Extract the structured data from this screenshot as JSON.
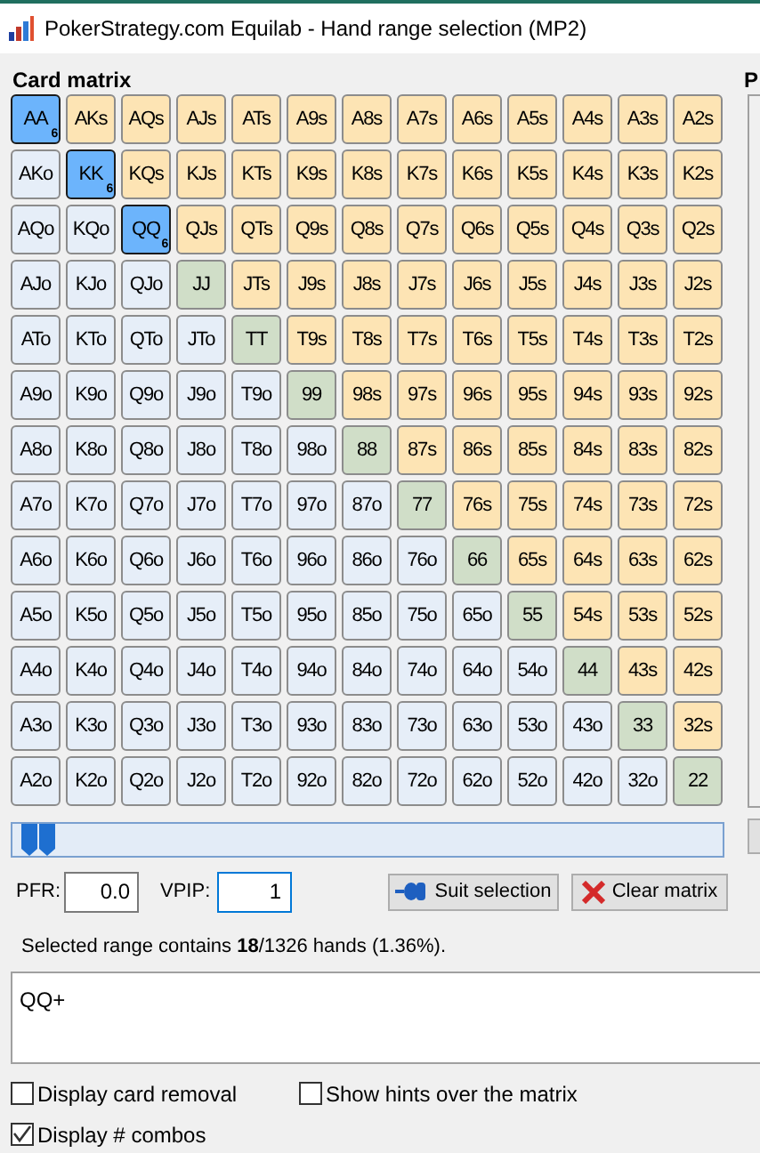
{
  "window": {
    "title": "PokerStrategy.com Equilab - Hand range selection (MP2)"
  },
  "card_matrix": {
    "title": "Card matrix",
    "rows": [
      [
        {
          "label": "AA",
          "kind": "pair",
          "selected": true,
          "combos": "6"
        },
        {
          "label": "AKs",
          "kind": "suited",
          "selected": false
        },
        {
          "label": "AQs",
          "kind": "suited",
          "selected": false
        },
        {
          "label": "AJs",
          "kind": "suited",
          "selected": false
        },
        {
          "label": "ATs",
          "kind": "suited",
          "selected": false
        },
        {
          "label": "A9s",
          "kind": "suited",
          "selected": false
        },
        {
          "label": "A8s",
          "kind": "suited",
          "selected": false
        },
        {
          "label": "A7s",
          "kind": "suited",
          "selected": false
        },
        {
          "label": "A6s",
          "kind": "suited",
          "selected": false
        },
        {
          "label": "A5s",
          "kind": "suited",
          "selected": false
        },
        {
          "label": "A4s",
          "kind": "suited",
          "selected": false
        },
        {
          "label": "A3s",
          "kind": "suited",
          "selected": false
        },
        {
          "label": "A2s",
          "kind": "suited",
          "selected": false
        }
      ],
      [
        {
          "label": "AKo",
          "kind": "offsuit",
          "selected": false
        },
        {
          "label": "KK",
          "kind": "pair",
          "selected": true,
          "combos": "6"
        },
        {
          "label": "KQs",
          "kind": "suited",
          "selected": false
        },
        {
          "label": "KJs",
          "kind": "suited",
          "selected": false
        },
        {
          "label": "KTs",
          "kind": "suited",
          "selected": false
        },
        {
          "label": "K9s",
          "kind": "suited",
          "selected": false
        },
        {
          "label": "K8s",
          "kind": "suited",
          "selected": false
        },
        {
          "label": "K7s",
          "kind": "suited",
          "selected": false
        },
        {
          "label": "K6s",
          "kind": "suited",
          "selected": false
        },
        {
          "label": "K5s",
          "kind": "suited",
          "selected": false
        },
        {
          "label": "K4s",
          "kind": "suited",
          "selected": false
        },
        {
          "label": "K3s",
          "kind": "suited",
          "selected": false
        },
        {
          "label": "K2s",
          "kind": "suited",
          "selected": false
        }
      ],
      [
        {
          "label": "AQo",
          "kind": "offsuit",
          "selected": false
        },
        {
          "label": "KQo",
          "kind": "offsuit",
          "selected": false
        },
        {
          "label": "QQ",
          "kind": "pair",
          "selected": true,
          "combos": "6"
        },
        {
          "label": "QJs",
          "kind": "suited",
          "selected": false
        },
        {
          "label": "QTs",
          "kind": "suited",
          "selected": false
        },
        {
          "label": "Q9s",
          "kind": "suited",
          "selected": false
        },
        {
          "label": "Q8s",
          "kind": "suited",
          "selected": false
        },
        {
          "label": "Q7s",
          "kind": "suited",
          "selected": false
        },
        {
          "label": "Q6s",
          "kind": "suited",
          "selected": false
        },
        {
          "label": "Q5s",
          "kind": "suited",
          "selected": false
        },
        {
          "label": "Q4s",
          "kind": "suited",
          "selected": false
        },
        {
          "label": "Q3s",
          "kind": "suited",
          "selected": false
        },
        {
          "label": "Q2s",
          "kind": "suited",
          "selected": false
        }
      ],
      [
        {
          "label": "AJo",
          "kind": "offsuit",
          "selected": false
        },
        {
          "label": "KJo",
          "kind": "offsuit",
          "selected": false
        },
        {
          "label": "QJo",
          "kind": "offsuit",
          "selected": false
        },
        {
          "label": "JJ",
          "kind": "pair",
          "selected": false
        },
        {
          "label": "JTs",
          "kind": "suited",
          "selected": false
        },
        {
          "label": "J9s",
          "kind": "suited",
          "selected": false
        },
        {
          "label": "J8s",
          "kind": "suited",
          "selected": false
        },
        {
          "label": "J7s",
          "kind": "suited",
          "selected": false
        },
        {
          "label": "J6s",
          "kind": "suited",
          "selected": false
        },
        {
          "label": "J5s",
          "kind": "suited",
          "selected": false
        },
        {
          "label": "J4s",
          "kind": "suited",
          "selected": false
        },
        {
          "label": "J3s",
          "kind": "suited",
          "selected": false
        },
        {
          "label": "J2s",
          "kind": "suited",
          "selected": false
        }
      ],
      [
        {
          "label": "ATo",
          "kind": "offsuit",
          "selected": false
        },
        {
          "label": "KTo",
          "kind": "offsuit",
          "selected": false
        },
        {
          "label": "QTo",
          "kind": "offsuit",
          "selected": false
        },
        {
          "label": "JTo",
          "kind": "offsuit",
          "selected": false
        },
        {
          "label": "TT",
          "kind": "pair",
          "selected": false
        },
        {
          "label": "T9s",
          "kind": "suited",
          "selected": false
        },
        {
          "label": "T8s",
          "kind": "suited",
          "selected": false
        },
        {
          "label": "T7s",
          "kind": "suited",
          "selected": false
        },
        {
          "label": "T6s",
          "kind": "suited",
          "selected": false
        },
        {
          "label": "T5s",
          "kind": "suited",
          "selected": false
        },
        {
          "label": "T4s",
          "kind": "suited",
          "selected": false
        },
        {
          "label": "T3s",
          "kind": "suited",
          "selected": false
        },
        {
          "label": "T2s",
          "kind": "suited",
          "selected": false
        }
      ],
      [
        {
          "label": "A9o",
          "kind": "offsuit",
          "selected": false
        },
        {
          "label": "K9o",
          "kind": "offsuit",
          "selected": false
        },
        {
          "label": "Q9o",
          "kind": "offsuit",
          "selected": false
        },
        {
          "label": "J9o",
          "kind": "offsuit",
          "selected": false
        },
        {
          "label": "T9o",
          "kind": "offsuit",
          "selected": false
        },
        {
          "label": "99",
          "kind": "pair",
          "selected": false
        },
        {
          "label": "98s",
          "kind": "suited",
          "selected": false
        },
        {
          "label": "97s",
          "kind": "suited",
          "selected": false
        },
        {
          "label": "96s",
          "kind": "suited",
          "selected": false
        },
        {
          "label": "95s",
          "kind": "suited",
          "selected": false
        },
        {
          "label": "94s",
          "kind": "suited",
          "selected": false
        },
        {
          "label": "93s",
          "kind": "suited",
          "selected": false
        },
        {
          "label": "92s",
          "kind": "suited",
          "selected": false
        }
      ],
      [
        {
          "label": "A8o",
          "kind": "offsuit",
          "selected": false
        },
        {
          "label": "K8o",
          "kind": "offsuit",
          "selected": false
        },
        {
          "label": "Q8o",
          "kind": "offsuit",
          "selected": false
        },
        {
          "label": "J8o",
          "kind": "offsuit",
          "selected": false
        },
        {
          "label": "T8o",
          "kind": "offsuit",
          "selected": false
        },
        {
          "label": "98o",
          "kind": "offsuit",
          "selected": false
        },
        {
          "label": "88",
          "kind": "pair",
          "selected": false
        },
        {
          "label": "87s",
          "kind": "suited",
          "selected": false
        },
        {
          "label": "86s",
          "kind": "suited",
          "selected": false
        },
        {
          "label": "85s",
          "kind": "suited",
          "selected": false
        },
        {
          "label": "84s",
          "kind": "suited",
          "selected": false
        },
        {
          "label": "83s",
          "kind": "suited",
          "selected": false
        },
        {
          "label": "82s",
          "kind": "suited",
          "selected": false
        }
      ],
      [
        {
          "label": "A7o",
          "kind": "offsuit",
          "selected": false
        },
        {
          "label": "K7o",
          "kind": "offsuit",
          "selected": false
        },
        {
          "label": "Q7o",
          "kind": "offsuit",
          "selected": false
        },
        {
          "label": "J7o",
          "kind": "offsuit",
          "selected": false
        },
        {
          "label": "T7o",
          "kind": "offsuit",
          "selected": false
        },
        {
          "label": "97o",
          "kind": "offsuit",
          "selected": false
        },
        {
          "label": "87o",
          "kind": "offsuit",
          "selected": false
        },
        {
          "label": "77",
          "kind": "pair",
          "selected": false
        },
        {
          "label": "76s",
          "kind": "suited",
          "selected": false
        },
        {
          "label": "75s",
          "kind": "suited",
          "selected": false
        },
        {
          "label": "74s",
          "kind": "suited",
          "selected": false
        },
        {
          "label": "73s",
          "kind": "suited",
          "selected": false
        },
        {
          "label": "72s",
          "kind": "suited",
          "selected": false
        }
      ],
      [
        {
          "label": "A6o",
          "kind": "offsuit",
          "selected": false
        },
        {
          "label": "K6o",
          "kind": "offsuit",
          "selected": false
        },
        {
          "label": "Q6o",
          "kind": "offsuit",
          "selected": false
        },
        {
          "label": "J6o",
          "kind": "offsuit",
          "selected": false
        },
        {
          "label": "T6o",
          "kind": "offsuit",
          "selected": false
        },
        {
          "label": "96o",
          "kind": "offsuit",
          "selected": false
        },
        {
          "label": "86o",
          "kind": "offsuit",
          "selected": false
        },
        {
          "label": "76o",
          "kind": "offsuit",
          "selected": false
        },
        {
          "label": "66",
          "kind": "pair",
          "selected": false
        },
        {
          "label": "65s",
          "kind": "suited",
          "selected": false
        },
        {
          "label": "64s",
          "kind": "suited",
          "selected": false
        },
        {
          "label": "63s",
          "kind": "suited",
          "selected": false
        },
        {
          "label": "62s",
          "kind": "suited",
          "selected": false
        }
      ],
      [
        {
          "label": "A5o",
          "kind": "offsuit",
          "selected": false
        },
        {
          "label": "K5o",
          "kind": "offsuit",
          "selected": false
        },
        {
          "label": "Q5o",
          "kind": "offsuit",
          "selected": false
        },
        {
          "label": "J5o",
          "kind": "offsuit",
          "selected": false
        },
        {
          "label": "T5o",
          "kind": "offsuit",
          "selected": false
        },
        {
          "label": "95o",
          "kind": "offsuit",
          "selected": false
        },
        {
          "label": "85o",
          "kind": "offsuit",
          "selected": false
        },
        {
          "label": "75o",
          "kind": "offsuit",
          "selected": false
        },
        {
          "label": "65o",
          "kind": "offsuit",
          "selected": false
        },
        {
          "label": "55",
          "kind": "pair",
          "selected": false
        },
        {
          "label": "54s",
          "kind": "suited",
          "selected": false
        },
        {
          "label": "53s",
          "kind": "suited",
          "selected": false
        },
        {
          "label": "52s",
          "kind": "suited",
          "selected": false
        }
      ],
      [
        {
          "label": "A4o",
          "kind": "offsuit",
          "selected": false
        },
        {
          "label": "K4o",
          "kind": "offsuit",
          "selected": false
        },
        {
          "label": "Q4o",
          "kind": "offsuit",
          "selected": false
        },
        {
          "label": "J4o",
          "kind": "offsuit",
          "selected": false
        },
        {
          "label": "T4o",
          "kind": "offsuit",
          "selected": false
        },
        {
          "label": "94o",
          "kind": "offsuit",
          "selected": false
        },
        {
          "label": "84o",
          "kind": "offsuit",
          "selected": false
        },
        {
          "label": "74o",
          "kind": "offsuit",
          "selected": false
        },
        {
          "label": "64o",
          "kind": "offsuit",
          "selected": false
        },
        {
          "label": "54o",
          "kind": "offsuit",
          "selected": false
        },
        {
          "label": "44",
          "kind": "pair",
          "selected": false
        },
        {
          "label": "43s",
          "kind": "suited",
          "selected": false
        },
        {
          "label": "42s",
          "kind": "suited",
          "selected": false
        }
      ],
      [
        {
          "label": "A3o",
          "kind": "offsuit",
          "selected": false
        },
        {
          "label": "K3o",
          "kind": "offsuit",
          "selected": false
        },
        {
          "label": "Q3o",
          "kind": "offsuit",
          "selected": false
        },
        {
          "label": "J3o",
          "kind": "offsuit",
          "selected": false
        },
        {
          "label": "T3o",
          "kind": "offsuit",
          "selected": false
        },
        {
          "label": "93o",
          "kind": "offsuit",
          "selected": false
        },
        {
          "label": "83o",
          "kind": "offsuit",
          "selected": false
        },
        {
          "label": "73o",
          "kind": "offsuit",
          "selected": false
        },
        {
          "label": "63o",
          "kind": "offsuit",
          "selected": false
        },
        {
          "label": "53o",
          "kind": "offsuit",
          "selected": false
        },
        {
          "label": "43o",
          "kind": "offsuit",
          "selected": false
        },
        {
          "label": "33",
          "kind": "pair",
          "selected": false
        },
        {
          "label": "32s",
          "kind": "suited",
          "selected": false
        }
      ],
      [
        {
          "label": "A2o",
          "kind": "offsuit",
          "selected": false
        },
        {
          "label": "K2o",
          "kind": "offsuit",
          "selected": false
        },
        {
          "label": "Q2o",
          "kind": "offsuit",
          "selected": false
        },
        {
          "label": "J2o",
          "kind": "offsuit",
          "selected": false
        },
        {
          "label": "T2o",
          "kind": "offsuit",
          "selected": false
        },
        {
          "label": "92o",
          "kind": "offsuit",
          "selected": false
        },
        {
          "label": "82o",
          "kind": "offsuit",
          "selected": false
        },
        {
          "label": "72o",
          "kind": "offsuit",
          "selected": false
        },
        {
          "label": "62o",
          "kind": "offsuit",
          "selected": false
        },
        {
          "label": "52o",
          "kind": "offsuit",
          "selected": false
        },
        {
          "label": "42o",
          "kind": "offsuit",
          "selected": false
        },
        {
          "label": "32o",
          "kind": "offsuit",
          "selected": false
        },
        {
          "label": "22",
          "kind": "pair",
          "selected": false
        }
      ]
    ]
  },
  "range_slider": {
    "level": 0.0136
  },
  "pfr": {
    "label": "PFR:",
    "value": "0.0"
  },
  "vpip": {
    "label": "VPIP:",
    "value": "1"
  },
  "buttons": [
    {
      "label": "Suit selection",
      "kind": "suit"
    },
    {
      "label": "Clear matrix",
      "kind": "clear"
    }
  ],
  "summary": "Selected range contains **18**/1326 hands (1.36%).",
  "range_text": "QQ+",
  "options": [
    {
      "label": "Display card removal",
      "checked": false
    },
    {
      "label": "Show hints over the matrix",
      "checked": false
    },
    {
      "label": "Display # combos",
      "checked": true
    }
  ],
  "right_panel": {
    "title": "P"
  }
}
